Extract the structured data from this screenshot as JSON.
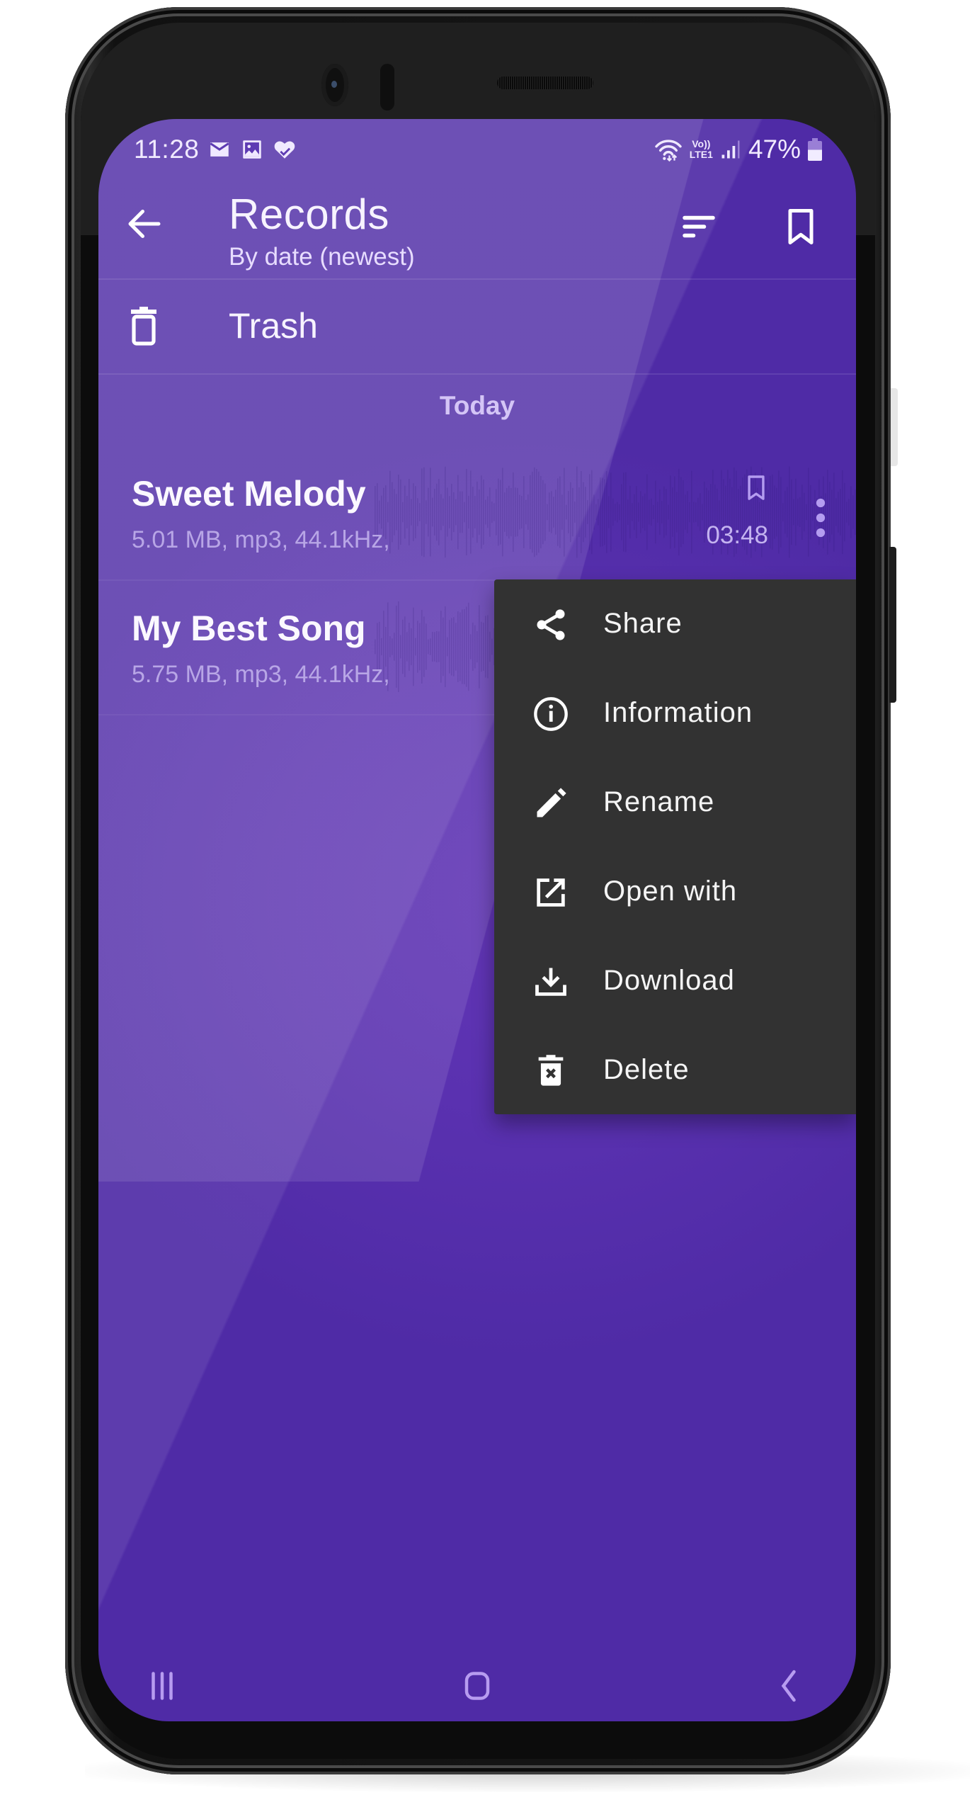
{
  "status_bar": {
    "time": "11:28",
    "notification_icons": [
      "mail-icon",
      "image-icon",
      "health-heart-icon"
    ],
    "system_icons": [
      "wifi-icon",
      "volte-icon",
      "signal-icon",
      "battery-icon"
    ],
    "network_label_top": "Vo))",
    "network_label_bottom": "LTE1",
    "battery_percent": "47%",
    "battery_level": 0.47
  },
  "toolbar": {
    "title": "Records",
    "subtitle": "By date (newest)",
    "back_icon": "arrow-left-icon",
    "sort_icon": "sort-icon",
    "bookmarks_icon": "bookmark-icon"
  },
  "trash": {
    "label": "Trash",
    "icon": "trash-icon"
  },
  "list": {
    "section_header": "Today",
    "records": [
      {
        "title": "Sweet Melody",
        "meta": "5.01 MB, mp3, 44.1kHz,",
        "duration": "03:48",
        "bookmarked": false
      },
      {
        "title": "My Best Song",
        "meta": "5.75 MB, mp3, 44.1kHz,",
        "duration": "",
        "bookmarked": false
      }
    ]
  },
  "context_menu": {
    "items": [
      {
        "label": "Share",
        "icon": "share-icon"
      },
      {
        "label": "Information",
        "icon": "info-icon"
      },
      {
        "label": "Rename",
        "icon": "pencil-icon"
      },
      {
        "label": "Open with",
        "icon": "open-external-icon"
      },
      {
        "label": "Download",
        "icon": "download-icon"
      },
      {
        "label": "Delete",
        "icon": "delete-icon"
      }
    ]
  },
  "nav_bar": {
    "recents_icon": "recents-icon",
    "home_icon": "home-icon",
    "back_icon": "nav-back-icon"
  },
  "colors": {
    "primary": "#5a31b0",
    "primary_light": "#6340b2",
    "menu_background": "#323232",
    "secondary_text": "#b8a6e6",
    "section_header": "#d4c5f6",
    "nav_icons": "#b79cf0"
  }
}
